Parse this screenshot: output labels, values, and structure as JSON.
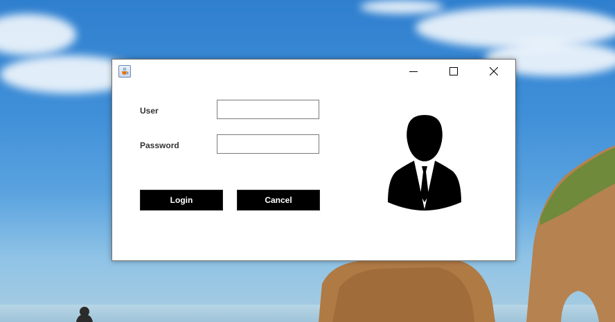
{
  "window": {
    "title": ""
  },
  "form": {
    "user_label": "User",
    "user_value": "",
    "password_label": "Password",
    "password_value": ""
  },
  "buttons": {
    "login_label": "Login",
    "cancel_label": "Cancel"
  },
  "icons": {
    "app": "java-cup-icon",
    "minimize": "minimize-icon",
    "maximize": "maximize-icon",
    "close": "close-icon",
    "avatar": "business-user-avatar-icon"
  },
  "colors": {
    "button_bg": "#000000",
    "button_text": "#ffffff",
    "window_bg": "#ffffff",
    "label_text": "#333333"
  }
}
